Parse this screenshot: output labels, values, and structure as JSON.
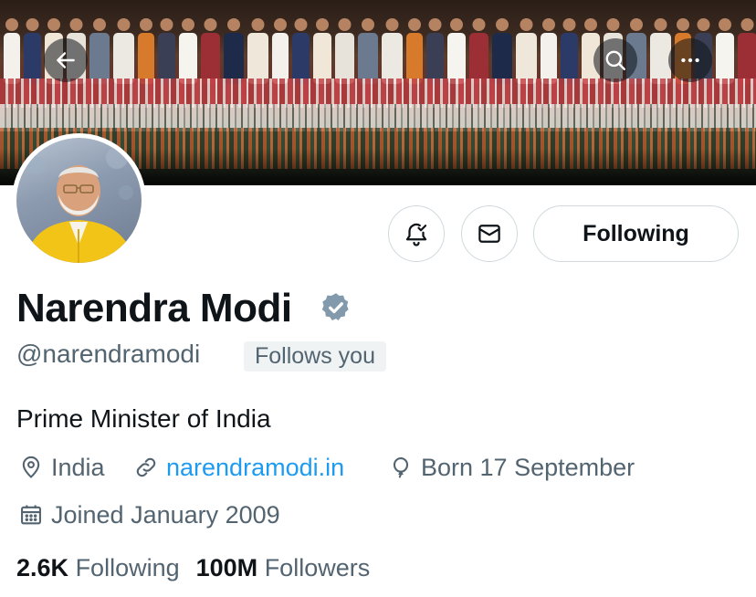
{
  "header": {
    "icons": {
      "back": "arrow-left-icon",
      "search": "search-icon",
      "more": "more-horizontal-icon"
    }
  },
  "profile": {
    "display_name": "Narendra Modi",
    "verified": true,
    "handle": "@narendramodi",
    "follows_you": "Follows you",
    "bio": "Prime Minister of India",
    "location": "India",
    "website": "narendramodi.in",
    "born": "Born 17 September",
    "joined": "Joined January 2009",
    "following_count": "2.6K",
    "following_label": "Following",
    "followers_count": "100M",
    "followers_label": "Followers"
  },
  "actions": {
    "following_button": "Following",
    "icons": {
      "notify": "bell-check-icon",
      "message": "envelope-icon"
    }
  },
  "colors": {
    "text_primary": "#0f1419",
    "text_secondary": "#536471",
    "link": "#1d9bf0",
    "badge_bg": "#eff3f4",
    "border": "#cfd9de",
    "verified": "#829aab",
    "avatar_vest": "#f2c418"
  }
}
